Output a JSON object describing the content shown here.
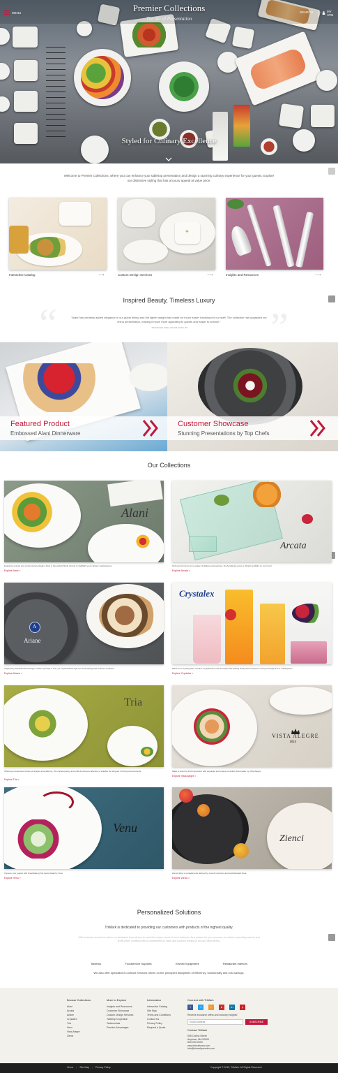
{
  "header": {
    "title": "Premier Collections",
    "subtitle": "The Art of Presentation",
    "menu_label": "MENU",
    "search_label": "SEARCH",
    "account_label": "MY ATM",
    "tagline": "Styled for Culinary Excellence"
  },
  "welcome": {
    "text": "Welcome to Premier Collections, where you can enhance your tabletop presentation and design a stunning culinary experience for your guests. Explore our distinctive styling that has a luxury appeal at value price."
  },
  "tiles": [
    {
      "label": "Interactive Catalog"
    },
    {
      "label": "Custom Design Services"
    },
    {
      "label": "Insights and Resources"
    }
  ],
  "testimonial": {
    "heading": "Inspired Beauty, Timeless Luxury",
    "quote": "\"Alani has certainly added elegance to our guest dining and the lighter weight has made for much easier handling for our staff. The collection has upgraded our china presentation, making it much more appealing to guests and easier to service.\"",
    "source": "- Paul Perrelli, Sales | Rental Center, TX"
  },
  "featured": [
    {
      "title": "Featured Product",
      "subtitle": "Embossed Alani Dinnerware"
    },
    {
      "title": "Customer Showcase",
      "subtitle": "Stunning Presentations by Top Chefs"
    }
  ],
  "collections": {
    "heading": "Our Collections",
    "items": [
      {
        "brand": "Alani",
        "desc": "Featuring a clean and contemporary design, Alani is the perfect blank canvas to highlight your culinary masterpieces.",
        "link": "Explore Alani >"
      },
      {
        "brand": "Arcata",
        "desc": "Giving prominence to a variety of tabletop accessories, the Arcata line gives a vibrant spotlight on your food.",
        "link": "Explore Arcata >"
      },
      {
        "brand": "Ariane",
        "desc": "Inspired by Sophisticated designs, Ariane portrays a soft, yet sophisticated style for showcasing bold cuisines creations.",
        "link": "Explore Ariane >"
      },
      {
        "brand": "Crystalex",
        "desc": "Made from crystal glass, this line of glassware and stemware has lasting clarity that transforms every beverage into a masterpiece.",
        "link": "Explore Crystalex >"
      },
      {
        "brand": "Tria",
        "desc": "Offering an extensive choice of shapes and patterns, this contemporary and multi-functional collection is suitable for all types of dining environments.",
        "link": "Explore Tria >"
      },
      {
        "brand": "VISTA ALEGRE",
        "brand_year": "1824",
        "desc": "Make a stunning first impression with exquisite and unique porcelain dinnerware by Vista Alegre.",
        "link": "Explore Vista Alegre >"
      },
      {
        "brand": "Venu",
        "desc": "Impress your guests with breathtaking first looks Detail by Venu.",
        "link": "Explore Venu >"
      },
      {
        "brand": "Zienci",
        "desc": "Zienci offers a versatile look defined by smooth contours and sophisticated hues.",
        "link": "Explore Zienci >"
      }
    ]
  },
  "personalized": {
    "heading": "Personalized Solutions",
    "subheading": "TriMark is dedicated to providing our customers with products of the highest quality.",
    "body": "With business across the nation our dedicated team strives to meet the unique needs of each business. As a partner for your success, we deliver essential products and profit-driven solutions with a commitment on value and superior results for all your Value Brand.",
    "categories": [
      "Tabletop",
      "Foodservice Supplies",
      "Kitchen Equipment",
      "Restaurant Interiors"
    ],
    "note": "We also offer specialized Contract Services driven on the principled disciplines of efficiency, functionality and cost savings."
  },
  "footer": {
    "columns": [
      {
        "heading": "Browse Collections",
        "items": [
          "Alani",
          "Arcata",
          "Ariane",
          "Crystalex",
          "Tria",
          "Venu",
          "Vista Alegre",
          "Zienci"
        ]
      },
      {
        "heading": "More to Explore",
        "items": [
          "Insights and Resources",
          "Customer Showcase",
          "Custom Design Services",
          "Tabletop Inspiration",
          "Testimonials",
          "Premier Advantages"
        ]
      },
      {
        "heading": "Information",
        "items": [
          "Interactive Catalog",
          "Site Map",
          "Terms and Conditions",
          "Contact Us",
          "Privacy Policy",
          "Request a Quote"
        ]
      }
    ],
    "connect": {
      "heading": "Connect with TriMark",
      "social": [
        "f",
        "t",
        "rss",
        "yt",
        "in",
        "p"
      ],
      "newsletter_text": "Receive exclusive offers and industry insights!",
      "email_placeholder": "Email Address",
      "subscribe_label": "SUBSCRIBE",
      "contact_heading": "Contact TriMark",
      "contact_lines": [
        "505 Collins Street",
        "Anytown, MA 00000",
        "800-000-0000",
        "www.trimarkusa.com",
        "info@trimarkpremier.com"
      ]
    },
    "bottom_links": [
      "Home",
      "Site Map",
      "Privacy Policy"
    ],
    "copyright": "Copyright © 2015, TriMark. All Rights Reserved."
  },
  "colors": {
    "accent": "#c1193c",
    "footer_bg": "#f3f1ec",
    "bottom_bar": "#1f1f1f"
  }
}
